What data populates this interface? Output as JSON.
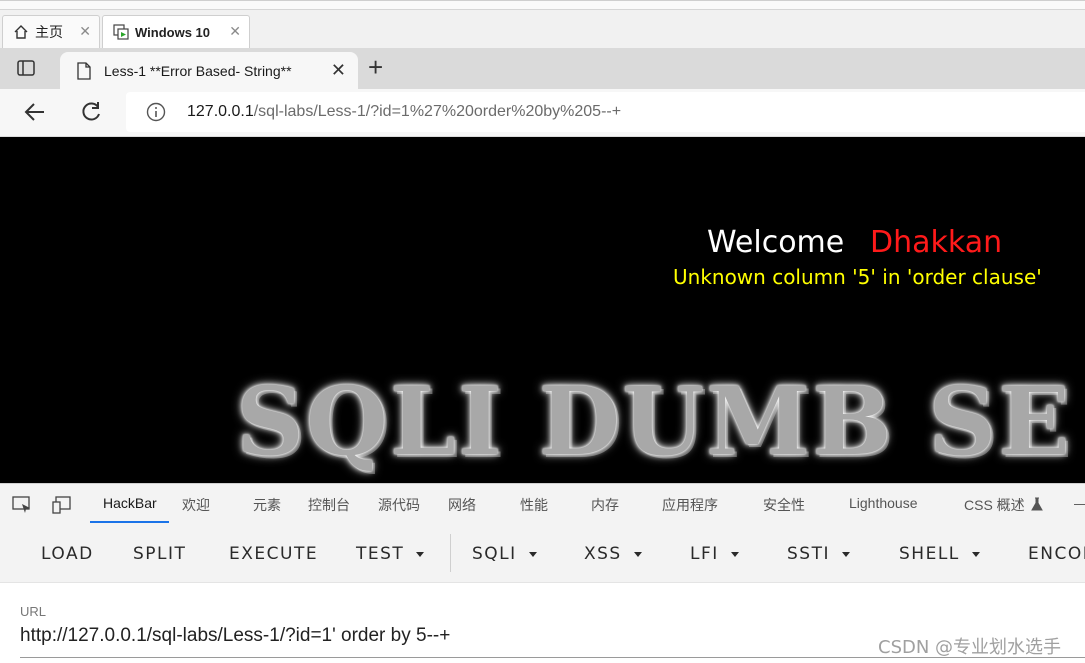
{
  "vm_tabs": [
    {
      "label": "主页",
      "icon": "home-icon"
    },
    {
      "label": "Windows 10",
      "icon": "vm-icon"
    }
  ],
  "browser": {
    "tab_title": "Less-1 **Error Based- String**",
    "address": {
      "host": "127.0.0.1",
      "path": "/sql-labs/Less-1/?id=1%27%20order%20by%205--+"
    }
  },
  "page": {
    "welcome": "Welcome",
    "username": "Dhakkan",
    "error_message": "Unknown column '5' in 'order clause'",
    "banner": "SQLI DUMB SE",
    "colors": {
      "background": "#000000",
      "username": "#ff1a1a",
      "error": "#ffff00"
    }
  },
  "devtools": {
    "tabs": [
      "HackBar",
      "欢迎",
      "元素",
      "控制台",
      "源代码",
      "网络",
      "性能",
      "内存",
      "应用程序",
      "安全性",
      "Lighthouse",
      "CSS 概述"
    ],
    "active_tab": "HackBar",
    "more": "—"
  },
  "hackbar": {
    "buttons": [
      "LOAD",
      "SPLIT",
      "EXECUTE",
      "TEST",
      "SQLI",
      "XSS",
      "LFI",
      "SSTI",
      "SHELL",
      "ENCOD"
    ],
    "url_label": "URL",
    "url_value": "http://127.0.0.1/sql-labs/Less-1/?id=1' order by 5--+"
  },
  "watermark": "CSDN @专业划水选手"
}
